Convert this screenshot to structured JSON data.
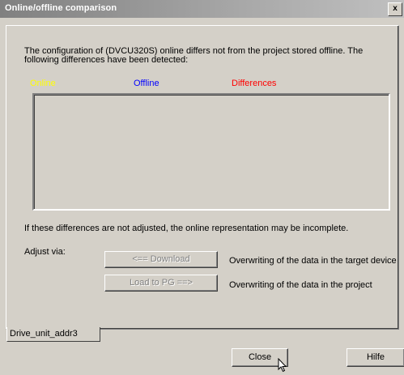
{
  "window": {
    "title": "Online/offline comparison",
    "close_glyph": "x"
  },
  "content": {
    "description": "The configuration of  (DVCU320S) online differs  not  from the project stored offline. The following differences have been detected:",
    "columns": {
      "online": "Online",
      "offline": "Offline",
      "differences": "Differences"
    },
    "warning": "If these differences are not adjusted, the online representation may be incomplete.",
    "adjust_label": "Adjust via:",
    "download_button": "<== Download",
    "download_desc": "Overwriting of the data in the target device",
    "load_button": "Load to PG ==>",
    "load_desc": "Overwriting of the data in the project"
  },
  "tabs": [
    {
      "label": "Drive_unit_addr3"
    }
  ],
  "footer": {
    "close_button": "Close",
    "help_button": "Hilfe"
  },
  "colors": {
    "online": "#ffff00",
    "offline": "#0000ff",
    "differences": "#ff0000",
    "window_bg": "#d4d0c8"
  },
  "icons": {
    "cursor": "mouse-pointer-icon"
  }
}
